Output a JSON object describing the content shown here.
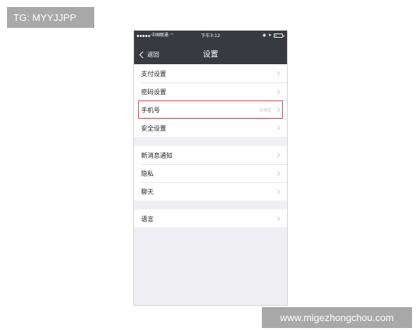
{
  "watermark": {
    "tag": "TG: MYYJJPP",
    "site": "www.migezhongchou.com"
  },
  "status_bar": {
    "carrier": "中国联通",
    "wifi_icon": "wifi-icon",
    "time": "下午3:12",
    "battery_level": 0.2
  },
  "nav": {
    "back_label": "返回",
    "title": "设置"
  },
  "groups": [
    [
      {
        "label": "支付设置",
        "value": ""
      },
      {
        "label": "密码设置",
        "value": ""
      },
      {
        "label": "手机号",
        "value": "未绑定",
        "highlighted": true
      },
      {
        "label": "安全设置",
        "value": ""
      }
    ],
    [
      {
        "label": "新消息通知",
        "value": ""
      },
      {
        "label": "隐私",
        "value": ""
      },
      {
        "label": "聊天",
        "value": ""
      }
    ],
    [
      {
        "label": "语言",
        "value": ""
      }
    ]
  ],
  "colors": {
    "nav_bg": "#393a3f",
    "page_bg": "#efeff4",
    "highlight": "#d9363e",
    "battery": "#4cd964"
  }
}
